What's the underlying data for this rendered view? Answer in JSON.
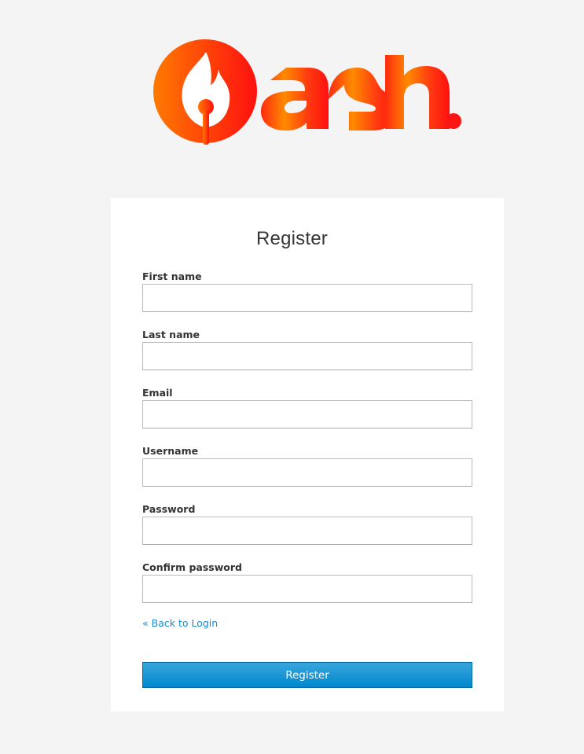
{
  "brand": {
    "logo_text": "ash.",
    "colors": {
      "logo_orange": "#ff7a00",
      "logo_red": "#ff1414",
      "background": "#f4f4f4",
      "card": "#ffffff",
      "link": "#1a8ccf",
      "button_top": "#39a5dc",
      "button_bottom": "#0088ce"
    }
  },
  "page": {
    "title": "Register"
  },
  "form": {
    "fields": [
      {
        "label": "First name",
        "value": "",
        "placeholder": ""
      },
      {
        "label": "Last name",
        "value": "",
        "placeholder": ""
      },
      {
        "label": "Email",
        "value": "",
        "placeholder": ""
      },
      {
        "label": "Username",
        "value": "",
        "placeholder": ""
      },
      {
        "label": "Password",
        "value": "",
        "placeholder": ""
      },
      {
        "label": "Confirm password",
        "value": "",
        "placeholder": ""
      }
    ],
    "back_link": "« Back to Login",
    "submit_label": "Register"
  }
}
